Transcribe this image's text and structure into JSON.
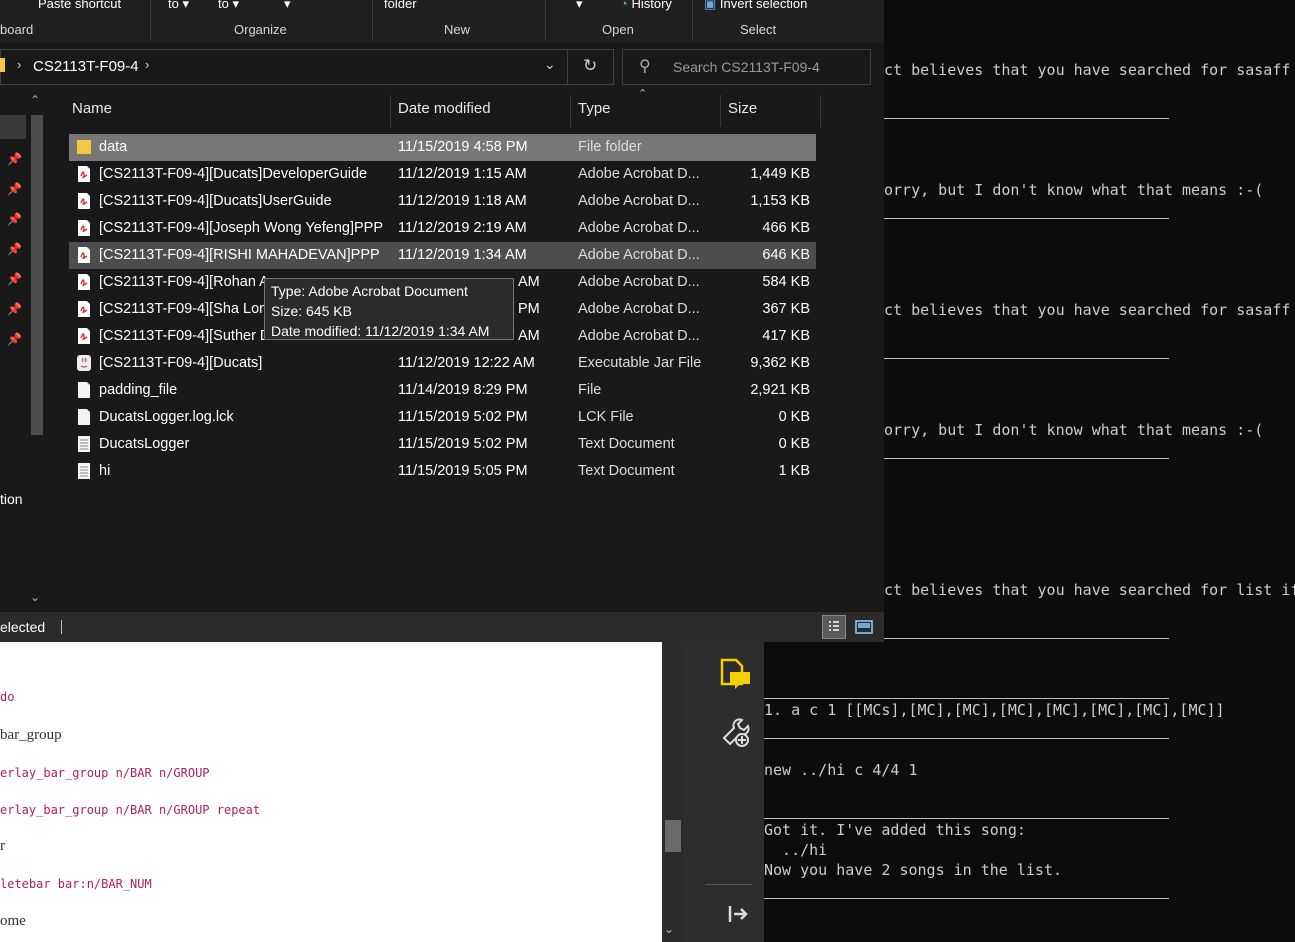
{
  "ribbon": {
    "top_items": [
      "Paste shortcut",
      "to ▾",
      "to ▾",
      "▾",
      "folder",
      "▾",
      "History",
      "Invert selection"
    ],
    "groups": [
      "board",
      "Organize",
      "New",
      "Open",
      "Select"
    ]
  },
  "address": {
    "breadcrumb": "CS2113T-F09-4",
    "search_placeholder": "Search CS2113T-F09-4"
  },
  "columns": {
    "name": "Name",
    "date": "Date modified",
    "type": "Type",
    "size": "Size"
  },
  "files": [
    {
      "icon": "folder-icon",
      "name": "data",
      "date": "11/15/2019 4:58 PM",
      "type": "File folder",
      "size": ""
    },
    {
      "icon": "pdf-icon",
      "name": "[CS2113T-F09-4][Ducats]DeveloperGuide",
      "date": "11/12/2019 1:15 AM",
      "type": "Adobe Acrobat D...",
      "size": "1,449 KB"
    },
    {
      "icon": "pdf-icon",
      "name": "[CS2113T-F09-4][Ducats]UserGuide",
      "date": "11/12/2019 1:18 AM",
      "type": "Adobe Acrobat D...",
      "size": "1,153 KB"
    },
    {
      "icon": "pdf-icon",
      "name": "[CS2113T-F09-4][Joseph Wong Yefeng]PPP",
      "date": "11/12/2019 2:19 AM",
      "type": "Adobe Acrobat D...",
      "size": "466 KB"
    },
    {
      "icon": "pdf-icon",
      "name": "[CS2113T-F09-4][RISHI MAHADEVAN]PPP",
      "date": "11/12/2019 1:34 AM",
      "type": "Adobe Acrobat D...",
      "size": "646 KB"
    },
    {
      "icon": "pdf-icon",
      "name": "[CS2113T-F09-4][Rohan A",
      "date": "AM",
      "type": "Adobe Acrobat D...",
      "size": "584 KB"
    },
    {
      "icon": "pdf-icon",
      "name": "[CS2113T-F09-4][Sha Lon",
      "date": "PM",
      "type": "Adobe Acrobat D...",
      "size": "367 KB"
    },
    {
      "icon": "pdf-icon",
      "name": "[CS2113T-F09-4][Suther D",
      "date": "AM",
      "type": "Adobe Acrobat D...",
      "size": "417 KB"
    },
    {
      "icon": "jar-icon",
      "name": "[CS2113T-F09-4][Ducats]",
      "date": "11/12/2019 12:22 AM",
      "type": "Executable Jar File",
      "size": "9,362 KB"
    },
    {
      "icon": "file-icon",
      "name": "padding_file",
      "date": "11/14/2019 8:29 PM",
      "type": "File",
      "size": "2,921 KB"
    },
    {
      "icon": "file-icon",
      "name": "DucatsLogger.log.lck",
      "date": "11/15/2019 5:02 PM",
      "type": "LCK File",
      "size": "0 KB"
    },
    {
      "icon": "text-file-icon",
      "name": "DucatsLogger",
      "date": "11/15/2019 5:02 PM",
      "type": "Text Document",
      "size": "0 KB"
    },
    {
      "icon": "text-file-icon",
      "name": "hi",
      "date": "11/15/2019 5:05 PM",
      "type": "Text Document",
      "size": "1 KB"
    }
  ],
  "tooltip": {
    "type": "Type: Adobe Acrobat Document",
    "size": "Size: 645 KB",
    "date": "Date modified: 11/12/2019 1:34 AM"
  },
  "nav": {
    "label_partial": "tion"
  },
  "status": {
    "text": "elected"
  },
  "terminal": {
    "lines": [
      "ct believes that you have searched for sasaff",
      "orry, but I don't know what that means :-(",
      "ct believes that you have searched for sasaff",
      "orry, but I don't know what that means :-(",
      "ct believes that you have searched for list if",
      "1. a c 1 [[MCs],[MC],[MC],[MC],[MC],[MC],[MC],[MC]]",
      "new ../hi c 4/4 1",
      "Got it. I've added this song:",
      "  ../hi",
      "Now you have 2 songs in the list."
    ]
  },
  "doc": {
    "lines": [
      "do",
      "bar_group",
      "erlay_bar_group n/BAR n/GROUP",
      "erlay_bar_group n/BAR n/GROUP repeat",
      "r",
      "letebar bar:n/BAR_NUM",
      "ome"
    ]
  },
  "colors": {
    "explorer_bg": "#191919",
    "selection": "#777777",
    "hover": "#4d4d4d",
    "code_text": "#b0205a",
    "pdf_red": "#d32f2f",
    "folder_yellow": "#f2c744",
    "sidebar_accent": "#f5d000"
  }
}
